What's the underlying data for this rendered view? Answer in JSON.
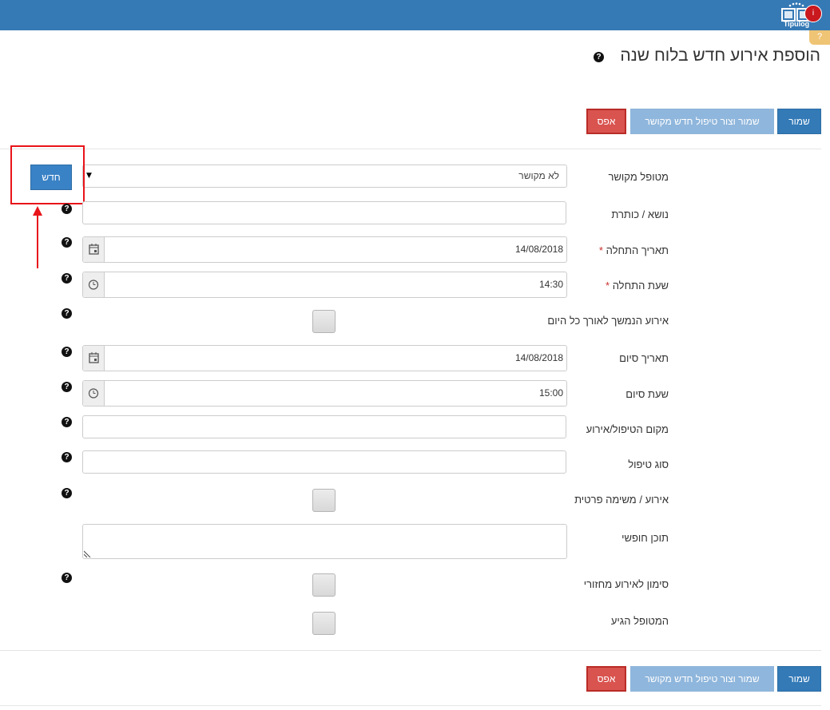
{
  "header": {
    "logo_text": "Tipulog",
    "badge": "i",
    "help_tab": "?"
  },
  "page": {
    "title": "הוספת אירוע חדש בלוח שנה",
    "title_help": "?"
  },
  "actions": {
    "save_label": "שמור",
    "save_related_label": "שמור וצור טיפול חדש מקושר",
    "reset_label": "אפס"
  },
  "form": {
    "linked_patient": {
      "label": "מטופל מקושר",
      "value": "לא מקושר",
      "new_label": "חדש"
    },
    "subject": {
      "label": "נושא / כותרת",
      "value": ""
    },
    "start_date": {
      "label": "תאריך התחלה",
      "required": "*",
      "value": "14/08/2018"
    },
    "start_time": {
      "label": "שעת התחלה",
      "required": "*",
      "value": "14:30"
    },
    "all_day": {
      "label": "אירוע הנמשך לאורך כל היום",
      "checked": false
    },
    "end_date": {
      "label": "תאריך סיום",
      "value": "14/08/2018"
    },
    "end_time": {
      "label": "שעת סיום",
      "value": "15:00"
    },
    "location": {
      "label": "מקום הטיפול/אירוע",
      "value": ""
    },
    "treatment_type": {
      "label": "סוג טיפול",
      "value": ""
    },
    "private_task": {
      "label": "אירוע / משימה פרטית",
      "checked": false
    },
    "free_text": {
      "label": "תוכן חופשי",
      "value": ""
    },
    "recurring": {
      "label": "סימון לאירוע מחזורי",
      "checked": false
    },
    "patient_arrived": {
      "label": "המטופל הגיע",
      "checked": false
    }
  },
  "help_glyph": "?",
  "colors": {
    "header": "#3579b5",
    "primary": "#337ab7",
    "primary_light": "#8fb6dc",
    "danger": "#d9534f",
    "annotation": "#e8141a"
  }
}
